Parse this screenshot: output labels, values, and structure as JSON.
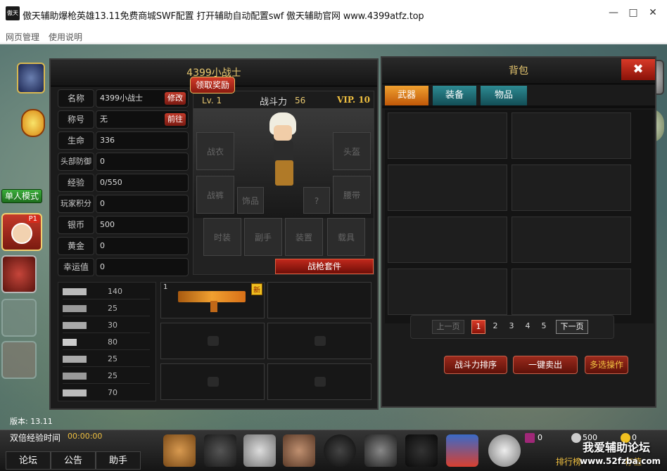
{
  "window": {
    "title": "傲天辅助爆枪英雄13.11免费商城SWF配置  打开辅助自动配置swf 傲天辅助官网 www.4399atfz.top",
    "app_icon_text": "傲天"
  },
  "menu": {
    "items": [
      "网页管理",
      "使用说明"
    ]
  },
  "side": {
    "mode_label": "单人模式",
    "p1_badge": "P1",
    "version": "版本: 13.11"
  },
  "character": {
    "title": "4399小战士",
    "reward_button": "领取奖励",
    "level": "Lv. 1",
    "power_label": "战斗力",
    "power_value": "56",
    "vip": "VIP. 10",
    "stats": [
      {
        "label": "名称",
        "value": "4399小战士",
        "button": "修改"
      },
      {
        "label": "称号",
        "value": "无",
        "button": "前往"
      },
      {
        "label": "生命",
        "value": "336"
      },
      {
        "label": "头部防御",
        "value": "0"
      },
      {
        "label": "经验",
        "value": "0/550"
      },
      {
        "label": "玩家积分",
        "value": "0"
      },
      {
        "label": "银币",
        "value": "500"
      },
      {
        "label": "黄金",
        "value": "0"
      },
      {
        "label": "幸运值",
        "value": "0"
      }
    ],
    "slots": {
      "armor": "战衣",
      "helmet": "头盔",
      "pants": "战裤",
      "accessory": "饰品",
      "unknown": "?",
      "belt": "腰带",
      "fashion": "时装",
      "offhand": "副手",
      "device": "装置",
      "vehicle": "载具"
    },
    "gun_set_button": "战枪套件",
    "weapon_values": [
      "140",
      "25",
      "30",
      "80",
      "25",
      "25",
      "70"
    ],
    "inventory": {
      "slot1_count": "1",
      "new_badge": "新"
    }
  },
  "backpack": {
    "title": "背包",
    "tabs": [
      "武器",
      "装备",
      "物品"
    ],
    "pagination": {
      "prev": "上一页",
      "pages": [
        "1",
        "2",
        "3",
        "4",
        "5"
      ],
      "next": "下一页"
    },
    "actions": [
      "战斗力排序",
      "一键卖出",
      "多选操作"
    ]
  },
  "bottom": {
    "double_exp_label": "双倍经验时间",
    "double_exp_time": "00:00:00",
    "tabs": [
      "论坛",
      "公告",
      "助手"
    ],
    "currency": {
      "red": "0",
      "silver": "500",
      "gold": "0"
    },
    "rank_label": "排行榜",
    "right_label": "存值"
  },
  "watermark": {
    "line1": "我爱辅助论坛",
    "line2": "www.52fzba.com"
  },
  "colors": {
    "accent_red": "#c0281c",
    "gold_text": "#e8c870",
    "tab_orange": "#e07818",
    "tab_teal": "#1f6a72"
  }
}
